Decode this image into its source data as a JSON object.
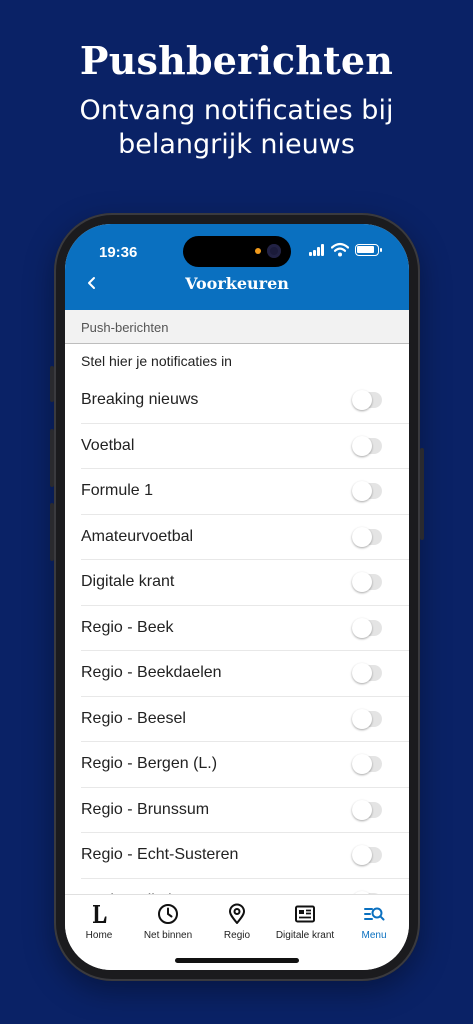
{
  "hero": {
    "title": "Pushberichten",
    "subtitle": "Ontvang notificaties bij belangrijk nieuws"
  },
  "status_bar": {
    "time": "19:36"
  },
  "nav": {
    "title": "Voorkeuren",
    "back_icon": "chevron-left-icon"
  },
  "section": {
    "header": "Push-berichten",
    "intro": "Stel hier je notificaties in"
  },
  "settings": [
    {
      "label": "Breaking nieuws",
      "enabled": false
    },
    {
      "label": "Voetbal",
      "enabled": false
    },
    {
      "label": "Formule 1",
      "enabled": false
    },
    {
      "label": "Amateurvoetbal",
      "enabled": false
    },
    {
      "label": "Digitale krant",
      "enabled": false
    },
    {
      "label": "Regio - Beek",
      "enabled": false
    },
    {
      "label": "Regio - Beekdaelen",
      "enabled": false
    },
    {
      "label": "Regio - Beesel",
      "enabled": false
    },
    {
      "label": "Regio - Bergen (L.)",
      "enabled": false
    },
    {
      "label": "Regio - Brunssum",
      "enabled": false
    },
    {
      "label": "Regio - Echt-Susteren",
      "enabled": false
    },
    {
      "label": "Regio - Eijsden-Margraten",
      "enabled": false
    }
  ],
  "tabbar": {
    "tabs": [
      {
        "label": "Home",
        "icon": "logo-l-icon"
      },
      {
        "label": "Net binnen",
        "icon": "clock-icon"
      },
      {
        "label": "Regio",
        "icon": "location-pin-icon"
      },
      {
        "label": "Digitale krant",
        "icon": "newspaper-icon"
      },
      {
        "label": "Menu",
        "icon": "menu-search-icon",
        "active": true
      }
    ]
  },
  "colors": {
    "background": "#0a2266",
    "accent": "#0a70c0"
  }
}
